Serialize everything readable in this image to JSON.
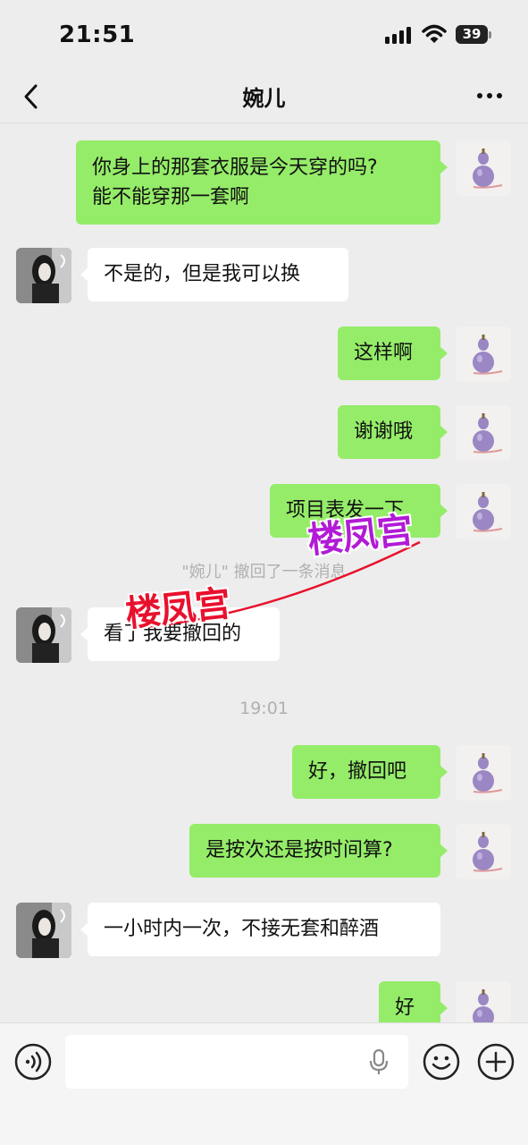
{
  "status_bar": {
    "time": "21:51",
    "battery": "39"
  },
  "header": {
    "title": "婉儿"
  },
  "messages": [
    {
      "side": "right",
      "lines": [
        "你身上的那套衣服是今天穿的吗?",
        "能不能穿那一套啊"
      ]
    },
    {
      "side": "left",
      "text": "不是的，但是我可以换"
    },
    {
      "side": "right",
      "text": "这样啊"
    },
    {
      "side": "right",
      "text": "谢谢哦"
    },
    {
      "side": "right",
      "text": "项目表发一下"
    },
    {
      "system": "\"婉儿\" 撤回了一条消息"
    },
    {
      "side": "left",
      "text": "看了我要撤回的"
    },
    {
      "timestamp": "19:01"
    },
    {
      "side": "right",
      "text": "好，撤回吧"
    },
    {
      "side": "right",
      "text": "是按次还是按时间算?"
    },
    {
      "side": "left",
      "text": "一小时内一次，不接无套和醉酒"
    },
    {
      "side": "right",
      "text": "好"
    }
  ],
  "watermark": {
    "text": "楼凤宫",
    "colors": [
      "#e8112d",
      "#b21ad6"
    ]
  },
  "icons": {
    "back": "chevron-left-icon",
    "more": "more-dots-icon",
    "voice": "voice-icon",
    "mic": "microphone-icon",
    "emoji": "emoji-icon",
    "plus": "plus-icon"
  },
  "colors": {
    "outgoing_bubble": "#95ec69",
    "incoming_bubble": "#ffffff",
    "background": "#ededed"
  }
}
